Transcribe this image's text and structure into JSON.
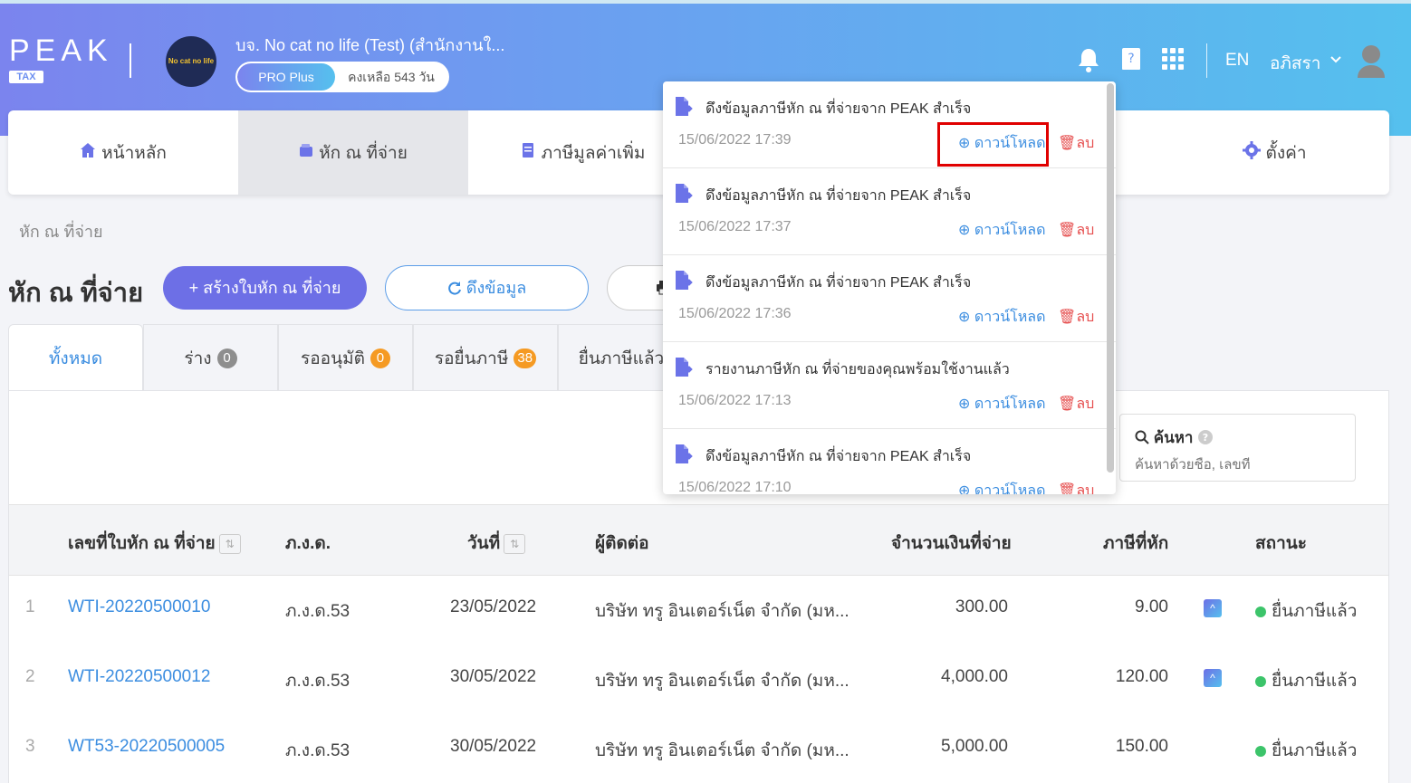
{
  "header": {
    "logo_text": "PEAK",
    "logo_sub": "TAX",
    "company_logo_text": "No cat no life",
    "company_name": "บจ. No cat no life (Test) (สำนักงานใ...",
    "plan_tier": "PRO Plus",
    "plan_days": "คงเหลือ 543 วัน",
    "language": "EN",
    "user_name": "อภิสรา",
    "icons": [
      "bell-icon",
      "book-icon",
      "apps-grid-icon",
      "chevron-down-icon",
      "user-avatar-icon"
    ]
  },
  "nav": {
    "items": [
      {
        "label": "หน้าหลัก",
        "icon": "home-icon"
      },
      {
        "label": "หัก ณ ที่จ่าย",
        "icon": "wallet-icon"
      },
      {
        "label": "ภาษีมูลค่าเพิ่ม",
        "icon": "document-icon"
      }
    ],
    "settings_label": "ตั้งค่า"
  },
  "breadcrumb": "หัก ณ ที่จ่าย",
  "page_title": "หัก ณ ที่จ่าย",
  "toolbar": {
    "create_label": "+ สร้างใบหัก ณ ที่จ่าย",
    "pull_label": "ดึงข้อมูล"
  },
  "tabs": [
    {
      "label": "ทั้งหมด",
      "count": null
    },
    {
      "label": "ร่าง",
      "count": "0",
      "color": "#8e8e8e"
    },
    {
      "label": "รออนุมัติ",
      "count": "0",
      "color": "#f59a23"
    },
    {
      "label": "รอยื่นภาษี",
      "count": "38",
      "color": "#f59a23"
    },
    {
      "label": "ยื่นภาษีแล้ว",
      "count": null
    }
  ],
  "search": {
    "label": "ค้นหา",
    "placeholder": "ค้นหาด้วยชื่อ, เลขที่"
  },
  "table": {
    "headers": {
      "doc_no": "เลขที่ใบหัก ณ ที่จ่าย",
      "form": "ภ.ง.ด.",
      "date": "วันที่",
      "contact": "ผู้ติดต่อ",
      "amount": "จำนวนเงินที่จ่าย",
      "tax": "ภาษีที่หัก",
      "status": "สถานะ"
    },
    "rows": [
      {
        "no": "1",
        "doc_no": "WTI-20220500010",
        "form": "ภ.ง.ด.53",
        "date": "23/05/2022",
        "contact": "บริษัท ทรู อินเตอร์เน็ต จำกัด (มห...",
        "amount": "300.00",
        "tax": "9.00",
        "peak": true,
        "status": "ยื่นภาษีแล้ว"
      },
      {
        "no": "2",
        "doc_no": "WTI-20220500012",
        "form": "ภ.ง.ด.53",
        "date": "30/05/2022",
        "contact": "บริษัท ทรู อินเตอร์เน็ต จำกัด (มห...",
        "amount": "4,000.00",
        "tax": "120.00",
        "peak": true,
        "status": "ยื่นภาษีแล้ว"
      },
      {
        "no": "3",
        "doc_no": "WT53-20220500005",
        "form": "ภ.ง.ด.53",
        "date": "30/05/2022",
        "contact": "บริษัท ทรู อินเตอร์เน็ต จำกัด (มห...",
        "amount": "5,000.00",
        "tax": "150.00",
        "peak": false,
        "status": "ยื่นภาษีแล้ว"
      }
    ]
  },
  "notifications": {
    "download_label": "ดาวน์โหลด",
    "delete_label": "ลบ",
    "items": [
      {
        "title": "ดึงข้อมูลภาษีหัก ณ ที่จ่ายจาก PEAK สำเร็จ",
        "time": "15/06/2022 17:39"
      },
      {
        "title": "ดึงข้อมูลภาษีหัก ณ ที่จ่ายจาก PEAK สำเร็จ",
        "time": "15/06/2022 17:37"
      },
      {
        "title": "ดึงข้อมูลภาษีหัก ณ ที่จ่ายจาก PEAK สำเร็จ",
        "time": "15/06/2022 17:36"
      },
      {
        "title": "รายงานภาษีหัก ณ ที่จ่ายของคุณพร้อมใช้งานแล้ว",
        "time": "15/06/2022 17:13"
      },
      {
        "title": "ดึงข้อมูลภาษีหัก ณ ที่จ่ายจาก PEAK สำเร็จ",
        "time": "15/06/2022 17:10"
      }
    ]
  },
  "colors": {
    "accent": "#6d6fe6",
    "link": "#3b8de0",
    "success": "#3cc46a",
    "danger": "#e65050",
    "highlight": "#e00000"
  }
}
